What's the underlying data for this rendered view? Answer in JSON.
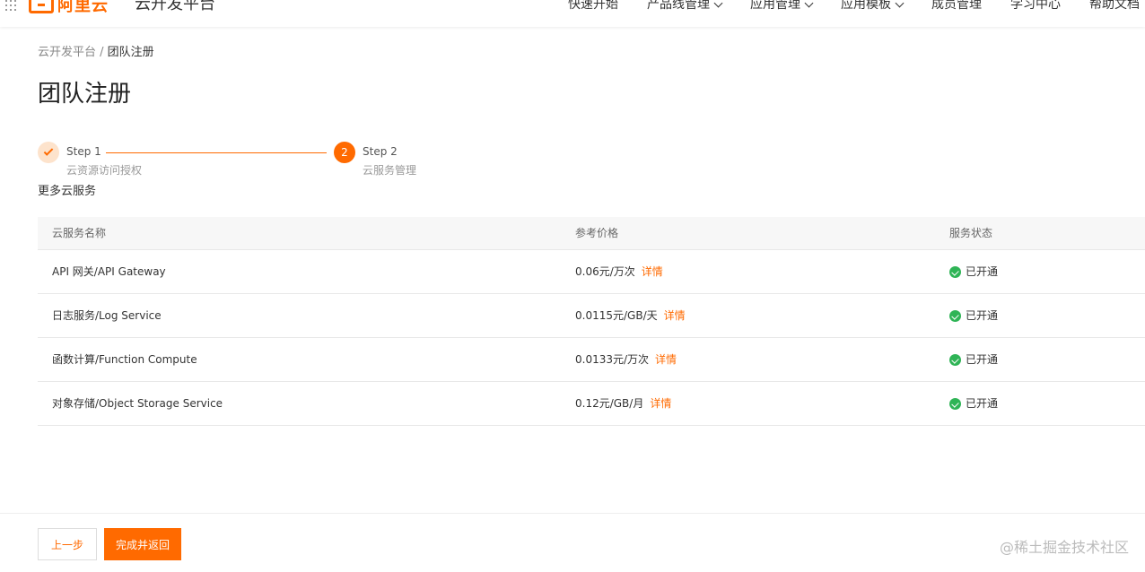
{
  "header": {
    "brand": "阿里云",
    "platform_name": "云开发平台",
    "nav": [
      {
        "label": "快速开始",
        "has_dropdown": false,
        "icon": "none"
      },
      {
        "label": "产品线管理",
        "has_dropdown": true,
        "icon": "chevron-down-icon"
      },
      {
        "label": "应用管理",
        "has_dropdown": true,
        "icon": "chevron-down-icon"
      },
      {
        "label": "应用模板",
        "has_dropdown": true,
        "icon": "chevron-down-icon"
      },
      {
        "label": "成员管理",
        "has_dropdown": false,
        "icon": "none"
      },
      {
        "label": "学习中心",
        "has_dropdown": false,
        "icon": "none"
      },
      {
        "label": "帮助文档",
        "has_dropdown": false,
        "icon": "none"
      }
    ]
  },
  "breadcrumb": {
    "root": "云开发平台",
    "separator": " / ",
    "current": "团队注册"
  },
  "page": {
    "title": "团队注册"
  },
  "steps": [
    {
      "title": "Step 1",
      "desc": "云资源访问授权",
      "status": "done",
      "icon": "check-icon"
    },
    {
      "title": "Step 2",
      "desc": "云服务管理",
      "status": "current",
      "number": "2"
    }
  ],
  "section": {
    "title": "更多云服务"
  },
  "table": {
    "headers": [
      "云服务名称",
      "参考价格",
      "服务状态"
    ],
    "rows": [
      {
        "name": "API 网关/API Gateway",
        "price": "0.06元/万次",
        "link": "详情",
        "status": "已开通"
      },
      {
        "name": "日志服务/Log Service",
        "price": "0.0115元/GB/天",
        "link": "详情",
        "status": "已开通"
      },
      {
        "name": "函数计算/Function Compute",
        "price": "0.0133元/万次",
        "link": "详情",
        "status": "已开通"
      },
      {
        "name": "对象存储/Object Storage Service",
        "price": "0.12元/GB/月",
        "link": "详情",
        "status": "已开通"
      }
    ]
  },
  "footer": {
    "prev_label": "上一步",
    "finish_label": "完成并返回"
  },
  "watermark": "@稀土掘金技术社区",
  "colors": {
    "accent": "#ff6a00",
    "success": "#2fb456",
    "step_done_bg": "#fde3cc"
  }
}
